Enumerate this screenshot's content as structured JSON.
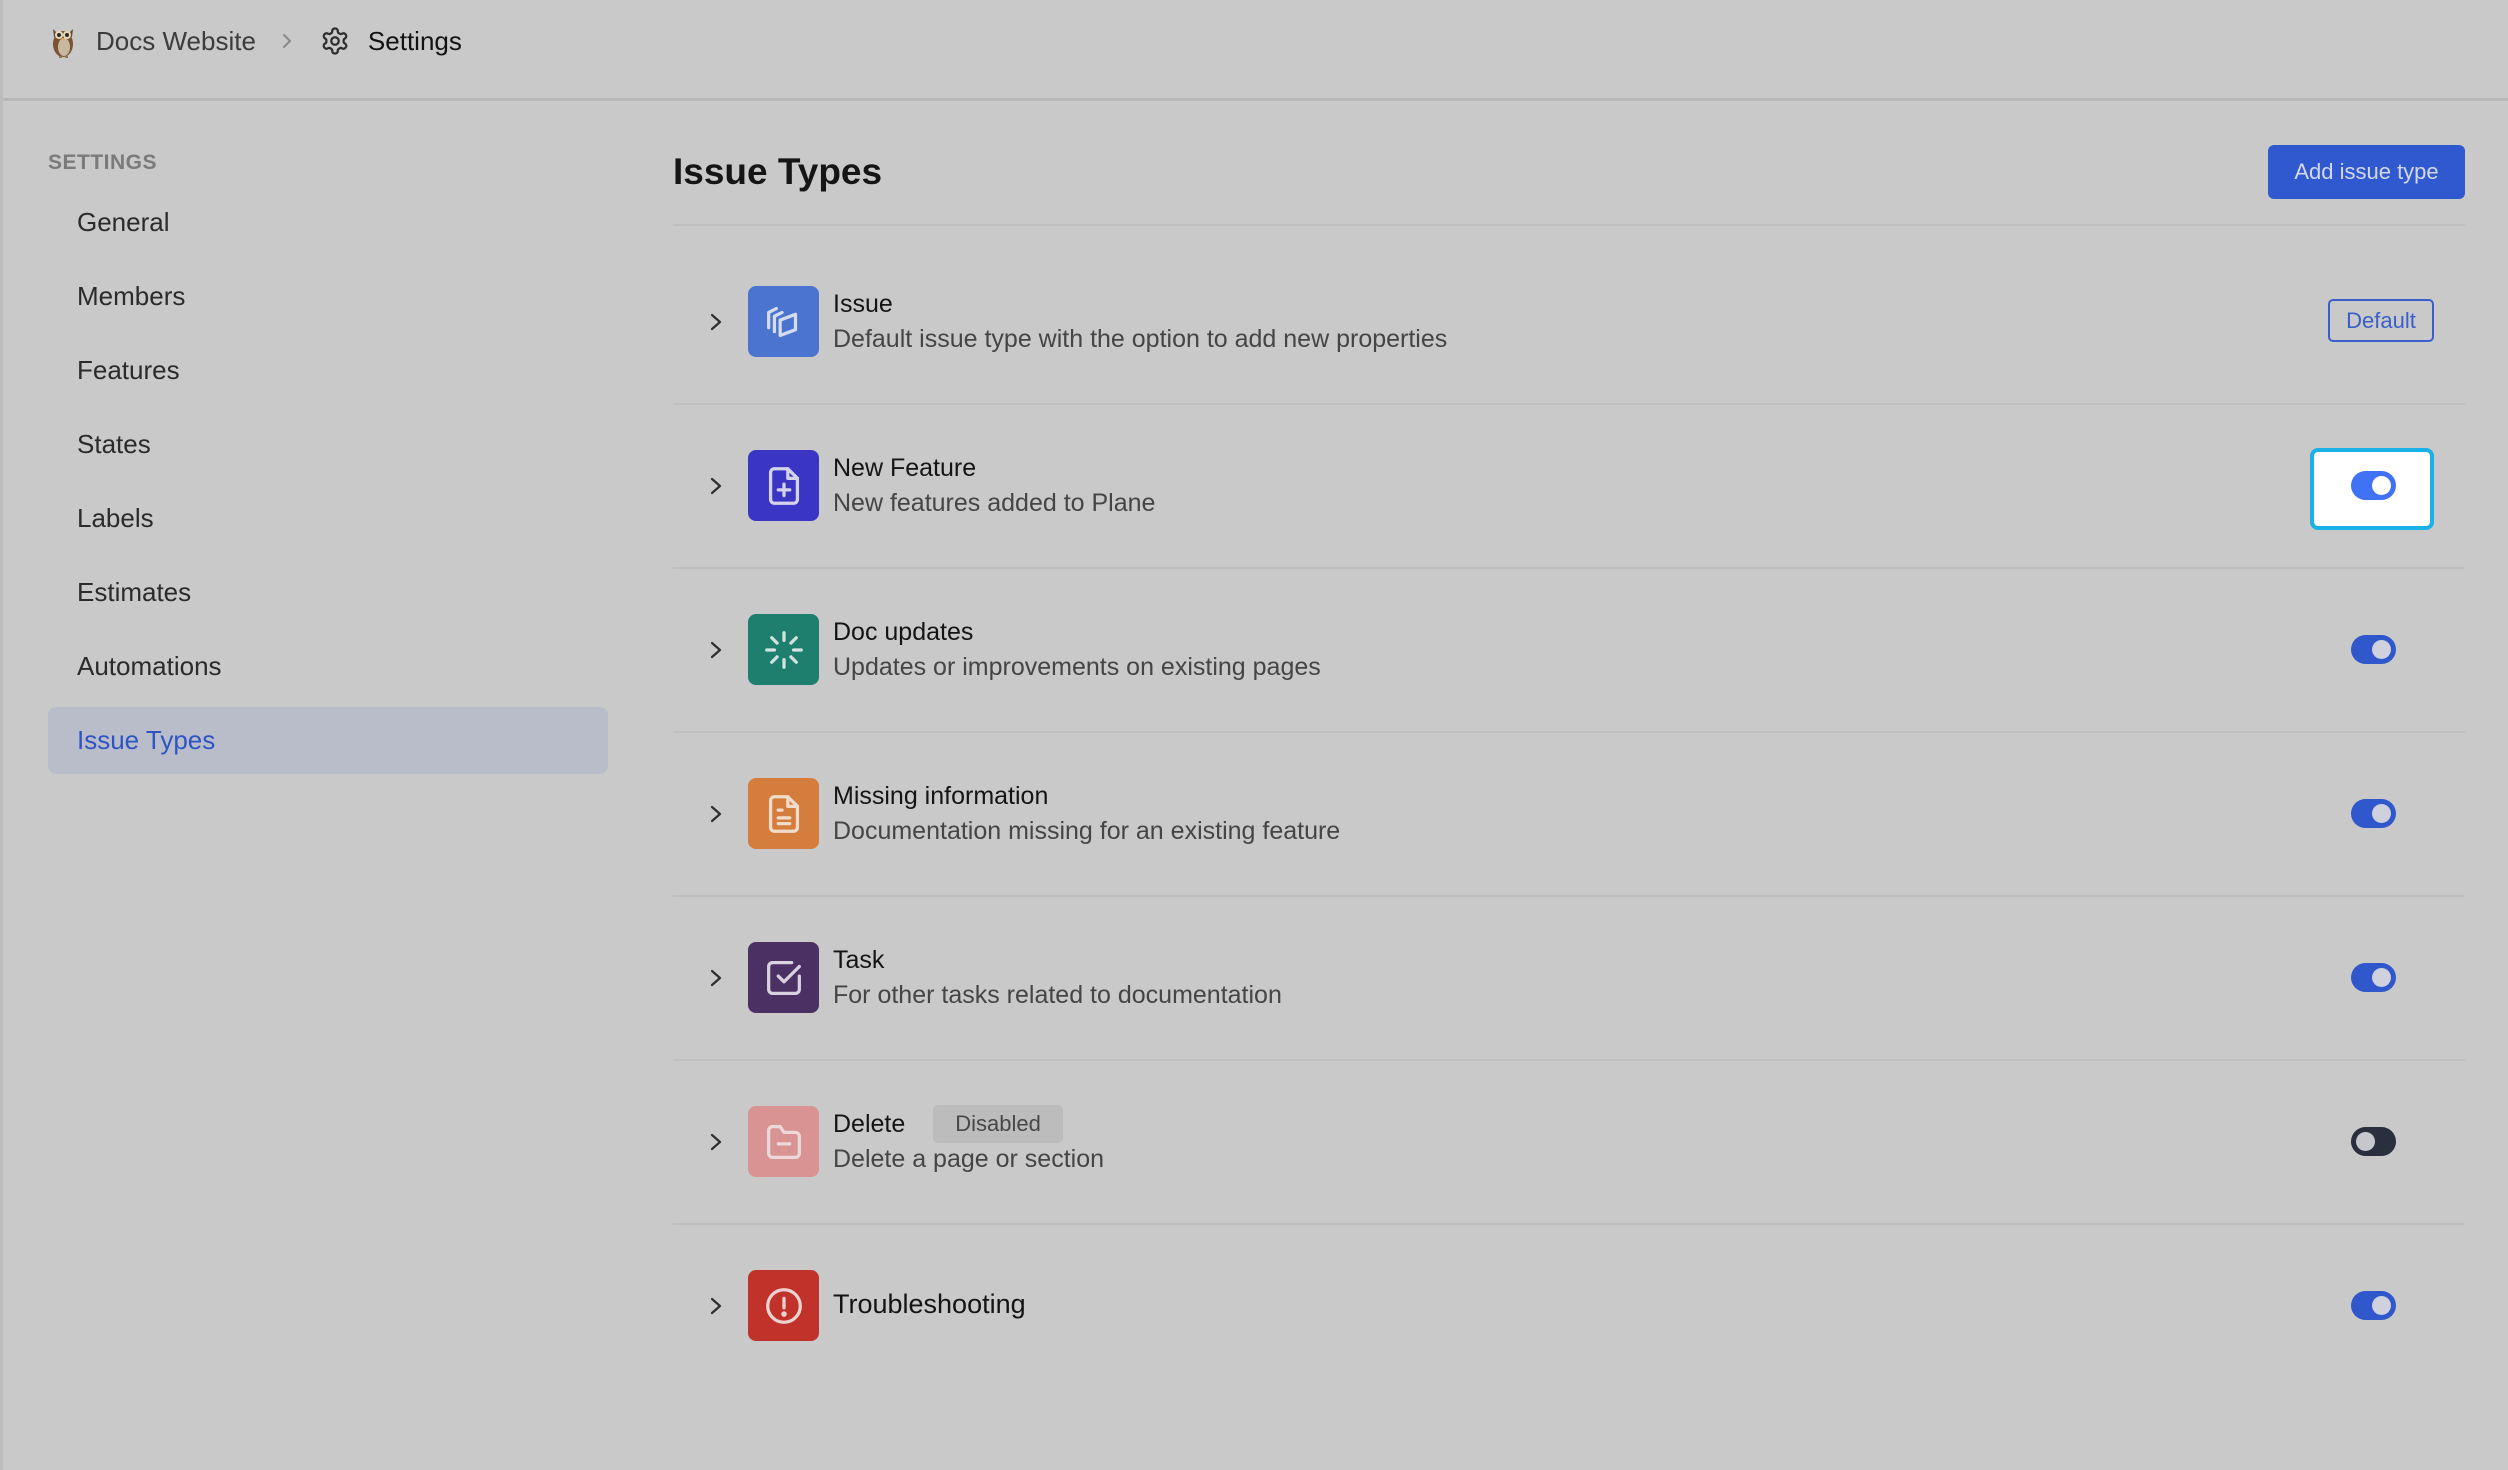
{
  "header": {
    "project_icon": "owl-emoji-icon",
    "project_name": "Docs Website",
    "separator_icon": "chevron-right-icon",
    "section_icon": "gear-icon",
    "section_name": "Settings"
  },
  "sidebar": {
    "heading": "SETTINGS",
    "items": [
      {
        "label": "General",
        "active": false
      },
      {
        "label": "Members",
        "active": false
      },
      {
        "label": "Features",
        "active": false
      },
      {
        "label": "States",
        "active": false
      },
      {
        "label": "Labels",
        "active": false
      },
      {
        "label": "Estimates",
        "active": false
      },
      {
        "label": "Automations",
        "active": false
      },
      {
        "label": "Issue Types",
        "active": true
      }
    ]
  },
  "main": {
    "title": "Issue Types",
    "add_button_label": "Add issue type",
    "default_badge": "Default",
    "disabled_badge": "Disabled",
    "issue_types": [
      {
        "name": "Issue",
        "description": "Default issue type with the option to add new properties",
        "icon": "layers-icon",
        "icon_color": "#4b74d1",
        "is_default": true,
        "enabled": true
      },
      {
        "name": "New Feature",
        "description": "New features added to Plane",
        "icon": "file-plus-icon",
        "icon_color": "#3b35c5",
        "is_default": false,
        "enabled": true,
        "focused": true
      },
      {
        "name": "Doc updates",
        "description": "Updates or improvements on existing pages",
        "icon": "loader-icon",
        "icon_color": "#1e7f6e",
        "is_default": false,
        "enabled": true
      },
      {
        "name": "Missing information",
        "description": "Documentation missing for an existing feature",
        "icon": "file-text-icon",
        "icon_color": "#d57d3d",
        "is_default": false,
        "enabled": true
      },
      {
        "name": "Task",
        "description": "For other tasks related to documentation",
        "icon": "square-check-icon",
        "icon_color": "#4b3064",
        "is_default": false,
        "enabled": true
      },
      {
        "name": "Delete",
        "description": "Delete a page or section",
        "icon": "folder-minus-icon",
        "icon_color": "#d99393",
        "is_default": false,
        "enabled": false
      },
      {
        "name": "Troubleshooting",
        "description": "",
        "icon": "alert-circle-icon",
        "icon_color": "#c0322a",
        "is_default": false,
        "enabled": true
      }
    ]
  }
}
